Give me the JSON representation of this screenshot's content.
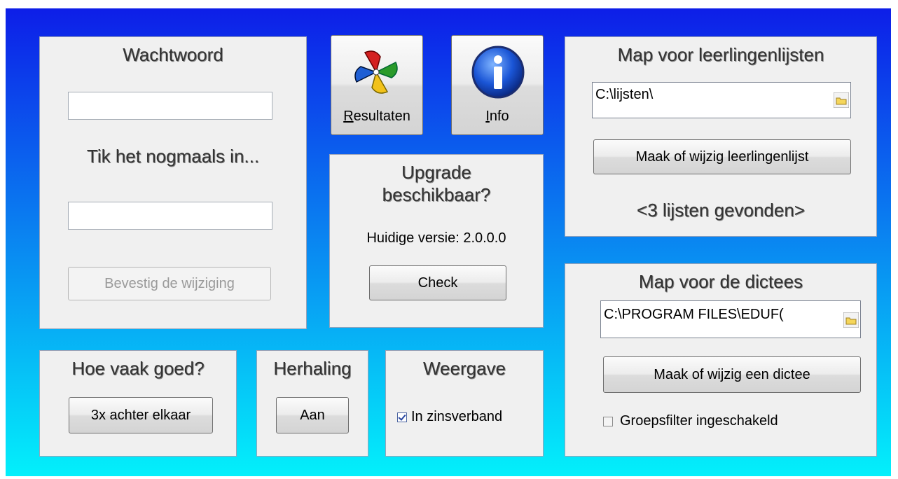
{
  "password": {
    "title": "Wachtwoord",
    "field1_value": "",
    "retype_label": "Tik het nogmaals in...",
    "field2_value": "",
    "confirm_label": "Bevestig de wijziging"
  },
  "toolbar": {
    "results_label": "Resultaten",
    "results_accel": "R",
    "results_rest": "esultaten",
    "info_label": "Info",
    "info_accel": "I",
    "info_rest": "nfo",
    "results_icon": "pinwheel-icon",
    "info_icon": "info-icon"
  },
  "upgrade": {
    "title_line1": "Upgrade",
    "title_line2": "beschikbaar?",
    "version_text": "Huidige versie: 2.0.0.0",
    "check_label": "Check"
  },
  "student_lists": {
    "title": "Map voor leerlingenlijsten",
    "path": "C:\\lijsten\\",
    "edit_label": "Maak of wijzig leerlingenlijst",
    "status": "<3 lijsten gevonden>"
  },
  "dictations": {
    "title": "Map voor de dictees",
    "path": "C:\\PROGRAM FILES\\EDUF(",
    "edit_label": "Maak of wijzig een dictee",
    "group_filter_label": "Groepsfilter ingeschakeld",
    "group_filter_checked": false
  },
  "how_often": {
    "title": "Hoe vaak goed?",
    "button_label": "3x achter elkaar"
  },
  "repeat": {
    "title": "Herhaling",
    "button_label": "Aan"
  },
  "display": {
    "title": "Weergave",
    "option_label": "In zinsverband",
    "option_checked": true
  },
  "colors": {
    "gradient_top": "#0d1ee8",
    "gradient_bottom": "#03f0fb",
    "panel": "#f0f0f0"
  }
}
